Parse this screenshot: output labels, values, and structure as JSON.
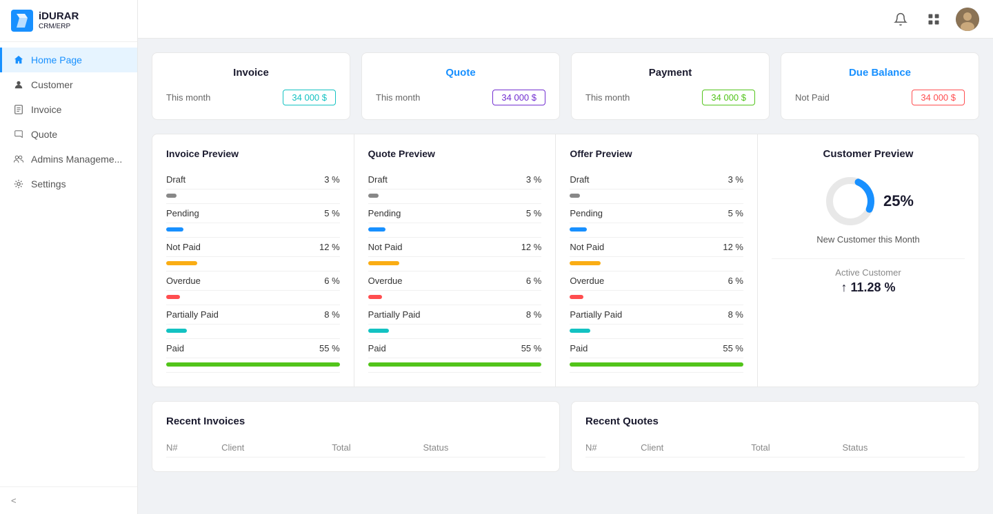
{
  "app": {
    "name": "iDURAR",
    "subtitle": "CRM/ERP"
  },
  "sidebar": {
    "items": [
      {
        "id": "home",
        "label": "Home Page",
        "icon": "🏠",
        "active": true
      },
      {
        "id": "customer",
        "label": "Customer",
        "icon": "👤",
        "active": false
      },
      {
        "id": "invoice",
        "label": "Invoice",
        "icon": "📄",
        "active": false
      },
      {
        "id": "quote",
        "label": "Quote",
        "icon": "🔖",
        "active": false
      },
      {
        "id": "admins",
        "label": "Admins Manageme...",
        "icon": "👥",
        "active": false
      },
      {
        "id": "settings",
        "label": "Settings",
        "icon": "⚙️",
        "active": false
      }
    ],
    "collapse_label": "<"
  },
  "summary_cards": [
    {
      "title": "Invoice",
      "title_color": "normal",
      "label": "This month",
      "value": "34 000 $",
      "badge_class": "badge-cyan"
    },
    {
      "title": "Quote",
      "title_color": "blue",
      "label": "This month",
      "value": "34 000 $",
      "badge_class": "badge-purple"
    },
    {
      "title": "Payment",
      "title_color": "normal",
      "label": "This month",
      "value": "34 000 $",
      "badge_class": "badge-green"
    },
    {
      "title": "Due Balance",
      "title_color": "blue",
      "label": "Not Paid",
      "value": "34 000 $",
      "badge_class": "badge-red"
    }
  ],
  "preview_panels": [
    {
      "title": "Invoice Preview",
      "rows": [
        {
          "label": "Draft",
          "value": "3 %",
          "bar_class": "bar-gray"
        },
        {
          "label": "Pending",
          "value": "5 %",
          "bar_class": "bar-blue"
        },
        {
          "label": "Not Paid",
          "value": "12 %",
          "bar_class": "bar-orange"
        },
        {
          "label": "Overdue",
          "value": "6 %",
          "bar_class": "bar-red"
        },
        {
          "label": "Partially Paid",
          "value": "8 %",
          "bar_class": "bar-cyan"
        },
        {
          "label": "Paid",
          "value": "55 %",
          "bar_class": "bar-green"
        }
      ]
    },
    {
      "title": "Quote Preview",
      "rows": [
        {
          "label": "Draft",
          "value": "3 %",
          "bar_class": "bar-gray"
        },
        {
          "label": "Pending",
          "value": "5 %",
          "bar_class": "bar-blue"
        },
        {
          "label": "Not Paid",
          "value": "12 %",
          "bar_class": "bar-orange"
        },
        {
          "label": "Overdue",
          "value": "6 %",
          "bar_class": "bar-red"
        },
        {
          "label": "Partially Paid",
          "value": "8 %",
          "bar_class": "bar-cyan"
        },
        {
          "label": "Paid",
          "value": "55 %",
          "bar_class": "bar-green"
        }
      ]
    },
    {
      "title": "Offer Preview",
      "rows": [
        {
          "label": "Draft",
          "value": "3 %",
          "bar_class": "bar-gray"
        },
        {
          "label": "Pending",
          "value": "5 %",
          "bar_class": "bar-blue"
        },
        {
          "label": "Not Paid",
          "value": "12 %",
          "bar_class": "bar-orange"
        },
        {
          "label": "Overdue",
          "value": "6 %",
          "bar_class": "bar-red"
        },
        {
          "label": "Partially Paid",
          "value": "8 %",
          "bar_class": "bar-cyan"
        },
        {
          "label": "Paid",
          "value": "55 %",
          "bar_class": "bar-green"
        }
      ]
    }
  ],
  "customer_preview": {
    "title": "Customer Preview",
    "percentage": "25%",
    "new_customer_label": "New Customer this Month",
    "active_customer_label": "Active Customer",
    "active_customer_value": "↑ 11.28 %"
  },
  "recent_invoices": {
    "title": "Recent Invoices",
    "columns": [
      "N#",
      "Client",
      "Total",
      "Status"
    ]
  },
  "recent_quotes": {
    "title": "Recent Quotes",
    "columns": [
      "N#",
      "Client",
      "Total",
      "Status"
    ]
  }
}
